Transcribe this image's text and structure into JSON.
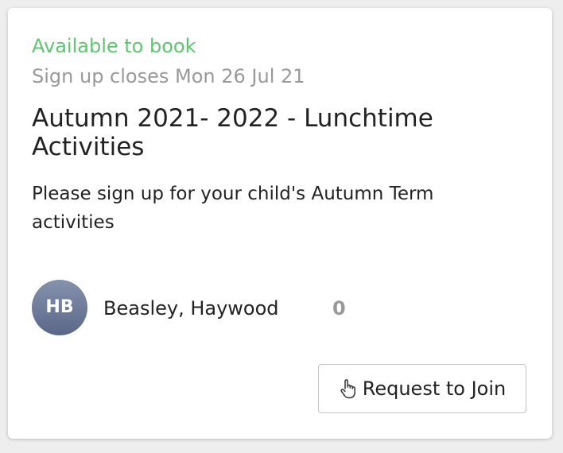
{
  "colors": {
    "status_available": "#5cc670",
    "muted_text": "#999999"
  },
  "booking": {
    "status": "Available to book",
    "closes": "Sign up closes Mon 26 Jul 21",
    "title": "Autumn 2021- 2022 - Lunchtime Activities",
    "description": "Please sign up for your child's Autumn Term activities"
  },
  "member": {
    "initials": "HB",
    "name": "Beasley, Haywood",
    "count": "0"
  },
  "actions": {
    "join_icon": "pointing-hand-icon",
    "join_label": "Request to Join"
  }
}
